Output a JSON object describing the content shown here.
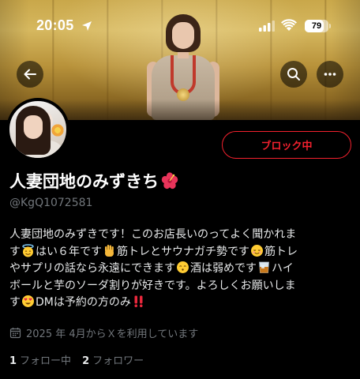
{
  "status_bar": {
    "time": "20:05",
    "battery_percent": "79",
    "battery_level": 0.79,
    "icons": [
      "location-arrow-icon",
      "cellular-signal-icon",
      "wifi-icon",
      "battery-icon"
    ]
  },
  "header": {
    "back_icon": "arrow-left-icon",
    "search_icon": "search-icon",
    "more_icon": "more-horizontal-icon"
  },
  "profile": {
    "block_button_label": "ブロック中",
    "display_name": "人妻団地のみずきち",
    "name_emoji": "hibiscus-icon",
    "handle": "@KgQ1072581",
    "bio_lines": [
      [
        "人妻団地のみずきです！このお店長いのってよく聞かれま"
      ],
      [
        "す",
        "はい６年です",
        "筋トレとサウナガチ勢です",
        "筋トレ"
      ],
      [
        "やサプリの話なら永遠にできます",
        "酒は弱めです",
        "ハイ"
      ],
      [
        "ボールと芋のソーダ割りが好きです。よろしくお願いしま"
      ],
      [
        "す",
        "DMは予約の方のみ"
      ]
    ],
    "joined_icon": "calendar-icon",
    "joined_text": "2025 年 4月からＸを利用しています",
    "following_count": "1",
    "following_label": "フォロー中",
    "followers_count": "2",
    "followers_label": "フォロワー"
  },
  "colors": {
    "background": "#000000",
    "block_red": "#f4212e",
    "secondary_text": "#71767b",
    "primary_text": "#e7e9ea"
  }
}
